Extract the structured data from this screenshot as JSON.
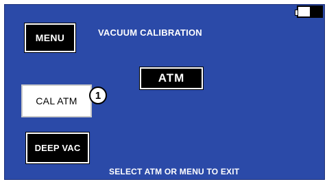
{
  "header": {
    "menu_label": "MENU",
    "title": "VACUUM CALIBRATION"
  },
  "battery": {
    "icon": "battery-icon",
    "level": 0.5
  },
  "status": {
    "value": "ATM"
  },
  "buttons": {
    "cal_atm_label": "CAL ATM",
    "deep_vac_label": "DEEP VAC"
  },
  "callout": {
    "number": "1"
  },
  "footer": {
    "instruction": "SELECT ATM OR MENU TO EXIT"
  },
  "colors": {
    "screen_background": "#2b4aa8",
    "button_dark": "#000000",
    "button_light": "#ffffff",
    "text": "#ffffff"
  }
}
